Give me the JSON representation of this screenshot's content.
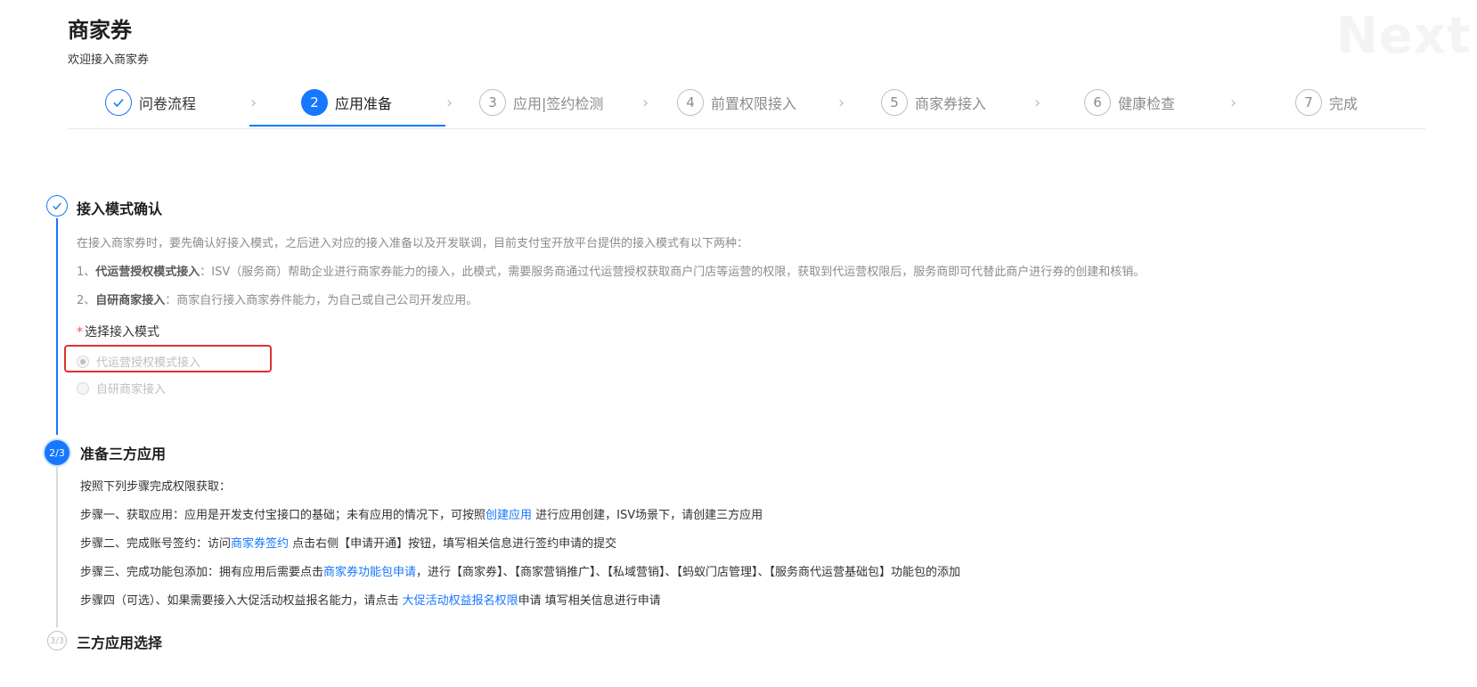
{
  "header": {
    "title": "商家券",
    "subtitle": "欢迎接入商家券",
    "watermark": "Next"
  },
  "steps": [
    {
      "num": "1",
      "label": "问卷流程",
      "status": "done"
    },
    {
      "num": "2",
      "label": "应用准备",
      "status": "active"
    },
    {
      "num": "3",
      "label": "应用|签约检测",
      "status": "wait"
    },
    {
      "num": "4",
      "label": "前置权限接入",
      "status": "wait"
    },
    {
      "num": "5",
      "label": "商家券接入",
      "status": "wait"
    },
    {
      "num": "6",
      "label": "健康检查",
      "status": "wait"
    },
    {
      "num": "7",
      "label": "完成",
      "status": "wait"
    }
  ],
  "sections": {
    "s1": {
      "title": "接入模式确认",
      "intro": "在接入商家券时，要先确认好接入模式，之后进入对应的接入准备以及开发联调，目前支付宝开放平台提供的接入模式有以下两种：",
      "item1_prefix": "1、",
      "item1_bold": "代运营授权模式接入",
      "item1_text": "：ISV（服务商）帮助企业进行商家券能力的接入，此模式，需要服务商通过代运营授权获取商户门店等运营的权限，获取到代运营权限后，服务商即可代替此商户进行券的创建和核销。",
      "item2_prefix": "2、",
      "item2_bold": "自研商家接入",
      "item2_text": "：商家自行接入商家券件能力，为自己或自己公司开发应用。",
      "required_star": "*",
      "select_label": "选择接入模式",
      "options": [
        "代运营授权模式接入",
        "自研商家接入"
      ],
      "selected_option": "代运营授权模式接入"
    },
    "s2": {
      "badge": "2/3",
      "title": "准备三方应用",
      "intro": "按照下列步骤完成权限获取：",
      "step1_a": "步骤一、获取应用：应用是开发支付宝接口的基础；未有应用的情况下，可按照",
      "step1_link": "创建应用",
      "step1_b": " 进行应用创建，ISV场景下，请创建三方应用",
      "step2_a": "步骤二、完成账号签约：访问",
      "step2_link": "商家券签约",
      "step2_b": " 点击右侧【申请开通】按钮，填写相关信息进行签约申请的提交",
      "step3_a": "步骤三、完成功能包添加：拥有应用后需要点击",
      "step3_link": "商家券功能包申请",
      "step3_b": "，进行【商家券】、【商家营销推广】、【私域营销】、【蚂蚁门店管理】、【服务商代运营基础包】功能包的添加",
      "step4_a": "步骤四（可选）、如果需要接入大促活动权益报名能力，请点击 ",
      "step4_link": "大促活动权益报名权限",
      "step4_b": "申请 填写相关信息进行申请"
    },
    "s3": {
      "badge": "3/3",
      "title": "三方应用选择"
    }
  },
  "colors": {
    "primary": "#1677ff",
    "highlight": "#e03131",
    "required": "#ff4d4f"
  },
  "icons": {
    "done_step": "check-icon",
    "separator": "chevron-right-icon"
  }
}
